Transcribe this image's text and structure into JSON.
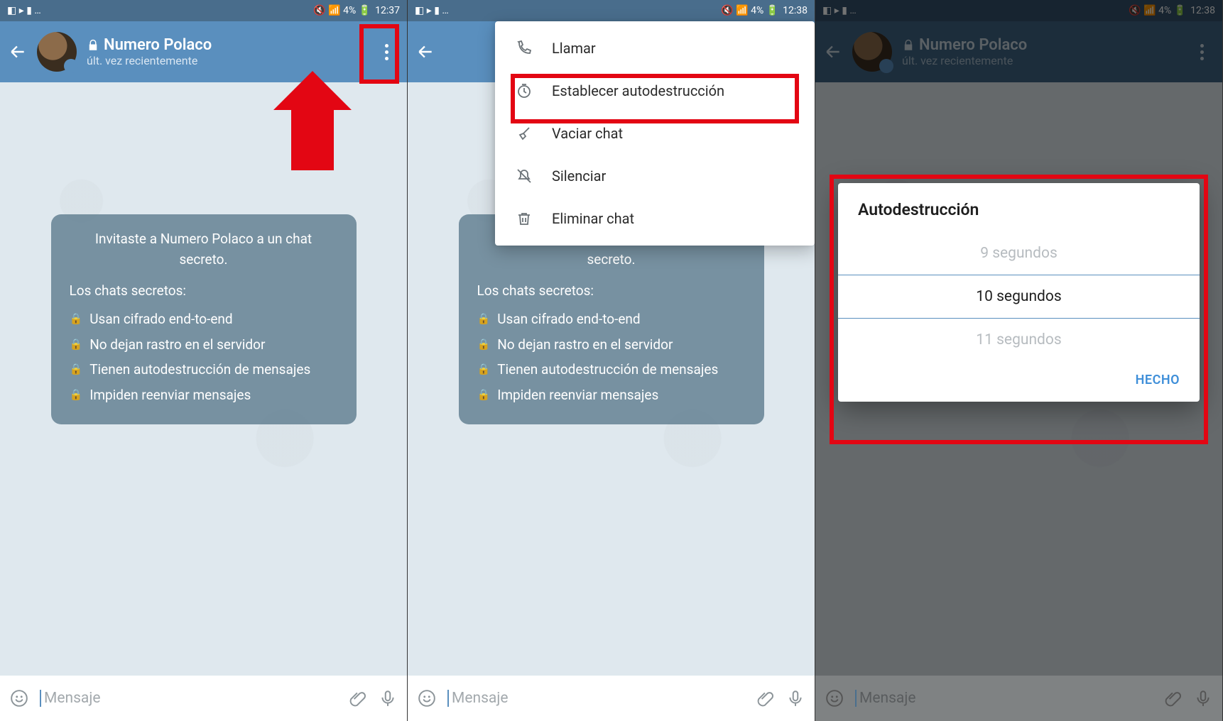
{
  "status": {
    "left_icons": "◧ ▸ ▮ …",
    "right_icons": "🔇 📶 4% 🔋",
    "time_a": "12:37",
    "time_b": "12:38",
    "time_c": "12:38",
    "battery": "4%"
  },
  "header": {
    "title": "Numero Polaco",
    "subtitle": "últ. vez recientemente"
  },
  "info": {
    "intro": "Invitaste a Numero Polaco a un chat secreto.",
    "heading": "Los chats secretos:",
    "bullets": [
      "Usan cifrado end-to-end",
      "No dejan rastro en el servidor",
      "Tienen autodestrucción de mensajes",
      "Impiden reenviar mensajes"
    ]
  },
  "input": {
    "placeholder": "Mensaje"
  },
  "menu": {
    "items": [
      {
        "icon": "phone-icon",
        "label": "Llamar"
      },
      {
        "icon": "timer-icon",
        "label": "Establecer autodestrucción"
      },
      {
        "icon": "broom-icon",
        "label": "Vaciar chat"
      },
      {
        "icon": "mute-icon",
        "label": "Silenciar"
      },
      {
        "icon": "trash-icon",
        "label": "Eliminar chat"
      }
    ]
  },
  "dialog": {
    "title": "Autodestrucción",
    "options": [
      "9 segundos",
      "10 segundos",
      "11 segundos"
    ],
    "selected_index": 1,
    "done": "HECHO"
  }
}
